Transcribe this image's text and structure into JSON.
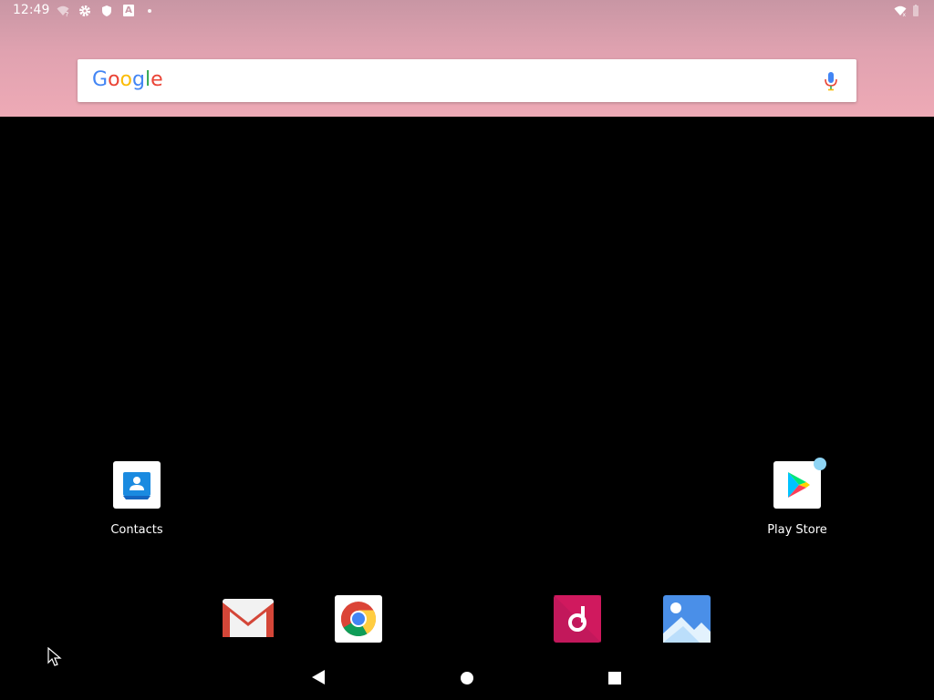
{
  "status_bar": {
    "time": "12:49",
    "left_icons": [
      "wifi-question-icon",
      "settings-gear-icon",
      "shield-icon",
      "a-badge-icon",
      "dot-icon"
    ],
    "right_icons": [
      "wifi-icon",
      "battery-icon"
    ]
  },
  "search": {
    "logo_letters": [
      "G",
      "o",
      "o",
      "g",
      "l",
      "e"
    ],
    "logo_colors": [
      "#4285F4",
      "#EA4335",
      "#FBBC05",
      "#4285F4",
      "#34A853",
      "#EA4335"
    ],
    "mic_icon": "mic-icon"
  },
  "home_apps": [
    {
      "label": "Contacts",
      "icon": "contacts-icon"
    },
    {
      "label": "Play Store",
      "icon": "play-store-icon",
      "has_notification_dot": true
    }
  ],
  "dock": [
    {
      "icon": "gmail-icon"
    },
    {
      "icon": "chrome-icon"
    },
    {
      "icon": "music-icon"
    },
    {
      "icon": "photos-icon"
    }
  ],
  "nav_bar": [
    "back-icon",
    "home-icon",
    "recents-icon"
  ],
  "colors": {
    "wallpaper_top": "#c896a4",
    "wallpaper_bottom": "#eeaab6",
    "background": "#000000"
  }
}
